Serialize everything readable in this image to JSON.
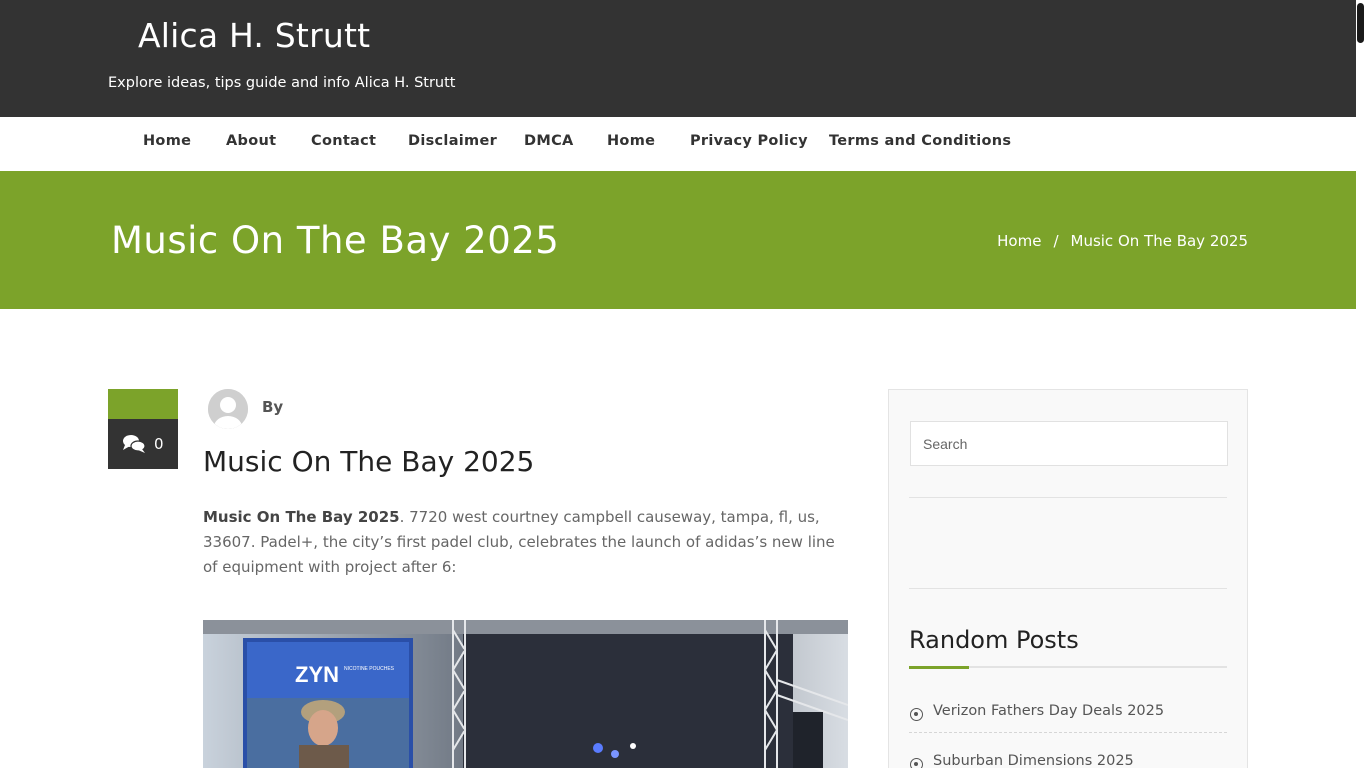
{
  "site": {
    "title": "Alica H. Strutt",
    "description": "Explore ideas, tips guide and info Alica H. Strutt"
  },
  "nav": [
    "Home",
    "About",
    "Contact",
    "Disclaimer",
    "DMCA",
    "Home",
    "Privacy Policy",
    "Terms and Conditions"
  ],
  "banner": {
    "title": "Music On The Bay 2025",
    "breadcrumb": {
      "home": "Home",
      "separator": "/",
      "current": "Music On The Bay 2025"
    }
  },
  "post": {
    "comment_count": "0",
    "by_label": "By",
    "title": "Music On The Bay 2025",
    "intro_bold": "Music On The Bay 2025",
    "intro_rest": ". 7720 west courtney campbell causeway, tampa, fl, us, 33607. Padel+, the city’s first padel club, celebrates the launch of adidas’s new line of equipment with project after 6:",
    "image_screen_text": "ZYN",
    "image_screen_subtext": "NICOTINE POUCHES"
  },
  "sidebar": {
    "search_placeholder": "Search",
    "random_posts_title": "Random Posts",
    "random_posts": [
      "Verizon Fathers Day Deals 2025",
      "Suburban Dimensions 2025"
    ]
  },
  "colors": {
    "header_bg": "#333333",
    "accent_green": "#7ca32a",
    "text_dark": "#222222"
  }
}
